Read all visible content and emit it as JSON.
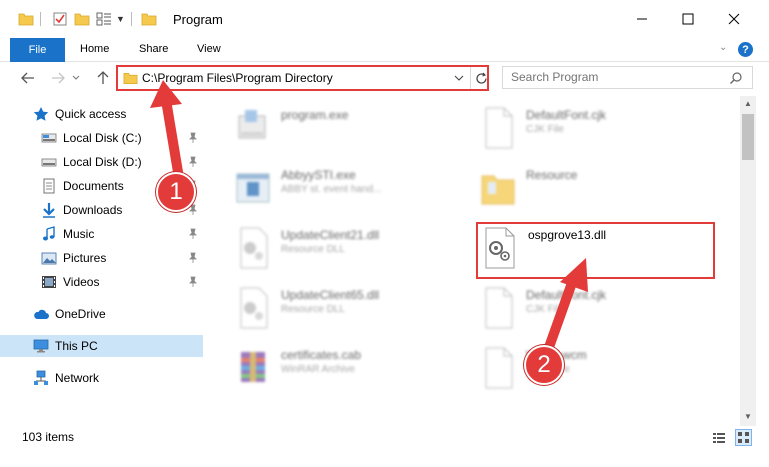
{
  "window": {
    "title": "Program",
    "minimize_glyph": "—",
    "maximize_glyph": "☐",
    "close_glyph": "✕"
  },
  "ribbon": {
    "tabs": [
      "File",
      "Home",
      "Share",
      "View"
    ],
    "expand_glyph": "⌄",
    "help_glyph": "?"
  },
  "navigation": {
    "address": "C:\\Program Files\\Program Directory",
    "search_placeholder": "Search Program"
  },
  "sidebar": {
    "items": [
      {
        "label": "Quick access",
        "icon": "star-icon",
        "pinned": false
      },
      {
        "label": "Local Disk (C:)",
        "icon": "drive-icon",
        "pinned": true
      },
      {
        "label": "Local Disk (D:)",
        "icon": "drive-icon",
        "pinned": true
      },
      {
        "label": "Documents",
        "icon": "documents-icon",
        "pinned": true
      },
      {
        "label": "Downloads",
        "icon": "download-icon",
        "pinned": true
      },
      {
        "label": "Music",
        "icon": "music-icon",
        "pinned": true
      },
      {
        "label": "Pictures",
        "icon": "pictures-icon",
        "pinned": true
      },
      {
        "label": "Videos",
        "icon": "video-icon",
        "pinned": true
      },
      {
        "label": "OneDrive",
        "icon": "cloud-icon",
        "pinned": false
      },
      {
        "label": "This PC",
        "icon": "computer-icon",
        "pinned": false,
        "selected": true
      },
      {
        "label": "Network",
        "icon": "network-icon",
        "pinned": false
      }
    ]
  },
  "files": [
    {
      "name": "program.exe",
      "type": "",
      "icon": "exe-icon",
      "blurred": true
    },
    {
      "name": "DefaultFont.cjk",
      "type": "CJK File",
      "icon": "file-icon",
      "blurred": true
    },
    {
      "name": "AbbyySTI.exe",
      "type": "ABBY st. event hand...",
      "icon": "exe-window-icon",
      "blurred": true
    },
    {
      "name": "Resource",
      "type": "",
      "icon": "folder-icon",
      "blurred": true
    },
    {
      "name": "UpdateClient21.dll",
      "type": "Resource DLL",
      "icon": "dll-icon",
      "blurred": true
    },
    {
      "name": "ospgrove13.dll",
      "type": "",
      "icon": "dll-icon",
      "blurred": false
    },
    {
      "name": "UpdateClient65.dll",
      "type": "Resource DLL",
      "icon": "dll-icon",
      "blurred": true
    },
    {
      "name": "DefaultFont.cjk",
      "type": "CJK File",
      "icon": "file-icon",
      "blurred": true
    },
    {
      "name": "certificates.cab",
      "type": "WinRAR Archive",
      "icon": "archive-icon",
      "blurred": true
    },
    {
      "name": "WP12.wcm",
      "type": "WCM File",
      "icon": "file-icon",
      "blurred": true
    }
  ],
  "status": {
    "item_count": "103 items"
  },
  "annotations": {
    "marker_1": "1",
    "marker_2": "2",
    "color": "#e33a3a"
  },
  "scrollbar": {
    "up_glyph": "▲",
    "down_glyph": "▼"
  },
  "colors": {
    "accent": "#1a73c8",
    "selected_bg": "#cce4f7",
    "highlight": "#e33a3a"
  }
}
